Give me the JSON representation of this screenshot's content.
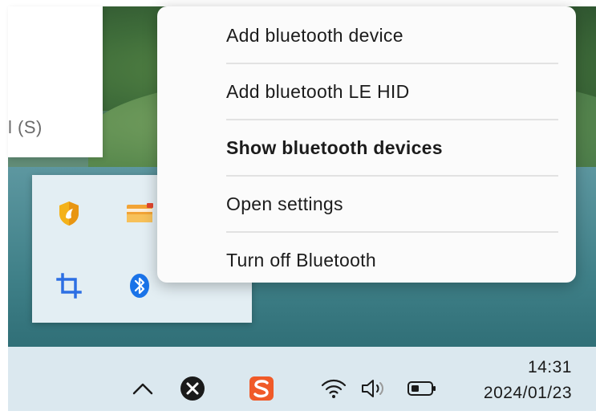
{
  "background_window": {
    "fragment_text": "l (S)"
  },
  "context_menu": {
    "items": [
      {
        "label": "Add bluetooth device",
        "bold": false
      },
      {
        "label": "Add bluetooth LE HID",
        "bold": false
      },
      {
        "label": "Show bluetooth devices",
        "bold": true
      },
      {
        "label": "Open settings",
        "bold": false
      },
      {
        "label": "Turn off Bluetooth",
        "bold": false
      }
    ]
  },
  "tray_flyout": {
    "icons": [
      "security-shield-icon",
      "folder-app-icon",
      "crop-icon",
      "bluetooth-icon"
    ]
  },
  "taskbar": {
    "icons": [
      "chevron-up-icon",
      "close-circle-icon",
      "sogou-input-icon",
      "wifi-icon",
      "speaker-icon",
      "battery-icon"
    ],
    "clock": {
      "time": "14:31",
      "date": "2024/01/23"
    }
  },
  "colors": {
    "menu_background": "#fbfbfb",
    "taskbar_background": "#dbe8ef",
    "flyout_background": "#e3eef3",
    "bluetooth_blue": "#1a73e8",
    "sogou_orange": "#f05a28"
  }
}
